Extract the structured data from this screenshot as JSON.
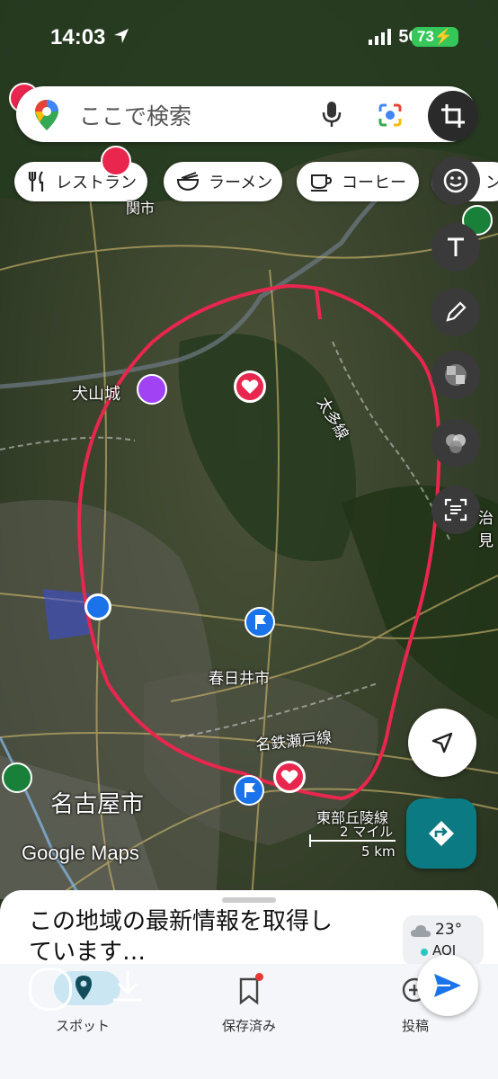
{
  "status_bar": {
    "time": "14:03",
    "network": "5G",
    "battery": "73"
  },
  "search": {
    "placeholder": "ここで検索"
  },
  "chips": [
    {
      "label": "レストラン",
      "icon": "fork-knife-icon"
    },
    {
      "label": "ラーメン",
      "icon": "ramen-bowl-icon"
    },
    {
      "label": "コーヒー",
      "icon": "coffee-cup-icon"
    },
    {
      "label": "ン",
      "icon": "emoji-icon"
    }
  ],
  "edit_tools": [
    "crop-icon",
    "emoji-icon",
    "text-icon",
    "pen-icon",
    "mosaic-icon",
    "blur-icon",
    "text-recognition-icon"
  ],
  "map_labels": {
    "seki": "関市",
    "inuyama": "犬山城",
    "taita": "太多線",
    "kasugai": "春日井市",
    "meitetsu": "名鉄瀬戸線",
    "nagoya": "名古屋市",
    "tobu": "東部丘陵線",
    "tajimi_edge": "治見",
    "brand": "Google Maps"
  },
  "scale": {
    "miles": "2 マイル",
    "km": "5 km"
  },
  "sheet": {
    "message": "この地域の最新情報を取得しています…",
    "temperature": "23°",
    "aqi": "AQI"
  },
  "tabs": [
    {
      "label": "スポット"
    },
    {
      "label": "保存済み"
    },
    {
      "label": "投稿"
    }
  ],
  "colors": {
    "accent": "#1a73e8",
    "annotation": "#e8264e",
    "directions": "#0b7a83"
  }
}
